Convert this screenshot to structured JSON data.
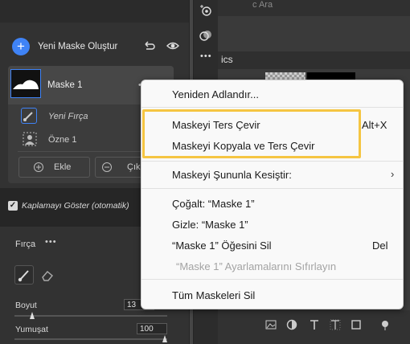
{
  "mask_panel": {
    "create_label": "Yeni Maske Oluştur",
    "mask_name": "Maske 1",
    "brush_label": "Yeni Fırça",
    "subject_label": "Özne 1",
    "add_label": "Ekle",
    "subtract_label": "Çıka"
  },
  "overlay": {
    "label": "Kaplamayı Göster (otomatik)",
    "checked": true
  },
  "brush_panel": {
    "title": "Fırça",
    "size_label": "Boyut",
    "size_value": "13",
    "feather_label": "Yumuşat",
    "feather_value": "100"
  },
  "canvas": {
    "title_fragment": "c Ara",
    "section_fragment": "ics"
  },
  "context_menu": {
    "rename": "Yeniden Adlandır...",
    "invert": "Maskeyi Ters Çevir",
    "invert_shortcut": "Alt+X",
    "duplicate_invert": "Maskeyi Kopyala ve Ters Çevir",
    "intersect": "Maskeyi Şununla Kesiştir:",
    "duplicate": "Çoğalt: “Maske 1”",
    "hide": "Gizle: “Maske 1”",
    "delete": "“Maske 1” Öğesini Sil",
    "delete_shortcut": "Del",
    "reset": "“Maske 1” Ayarlamalarını Sıfırlayın",
    "delete_all": "Tüm Maskeleri Sil"
  },
  "colors": {
    "accent": "#3f83f6",
    "highlight": "#f5c542"
  },
  "icons": [
    "plus-icon",
    "reset-icon",
    "eye-icon",
    "brush-icon",
    "subject-icon",
    "add-circle-icon",
    "subtract-circle-icon",
    "eraser-icon",
    "chevron-right-icon"
  ]
}
